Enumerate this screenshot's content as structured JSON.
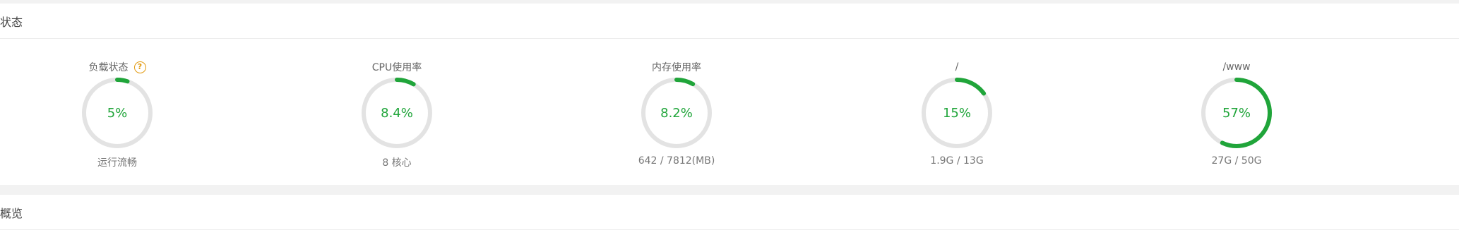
{
  "status_panel": {
    "title": "状态"
  },
  "overview_panel": {
    "title": "概览"
  },
  "colors": {
    "accent": "#20a53a",
    "track": "#e3e3e3",
    "help": "#e29a10"
  },
  "gauges": [
    {
      "title": "负载状态",
      "value": "5%",
      "percent": 5,
      "sub": "运行流畅",
      "help_icon": "?"
    },
    {
      "title": "CPU使用率",
      "value": "8.4%",
      "percent": 8.4,
      "sub": "8 核心"
    },
    {
      "title": "内存使用率",
      "value": "8.2%",
      "percent": 8.2,
      "sub": "642 / 7812(MB)"
    },
    {
      "title": "/",
      "value": "15%",
      "percent": 15,
      "sub": "1.9G / 13G"
    },
    {
      "title": "/www",
      "value": "57%",
      "percent": 57,
      "sub": "27G / 50G"
    }
  ]
}
